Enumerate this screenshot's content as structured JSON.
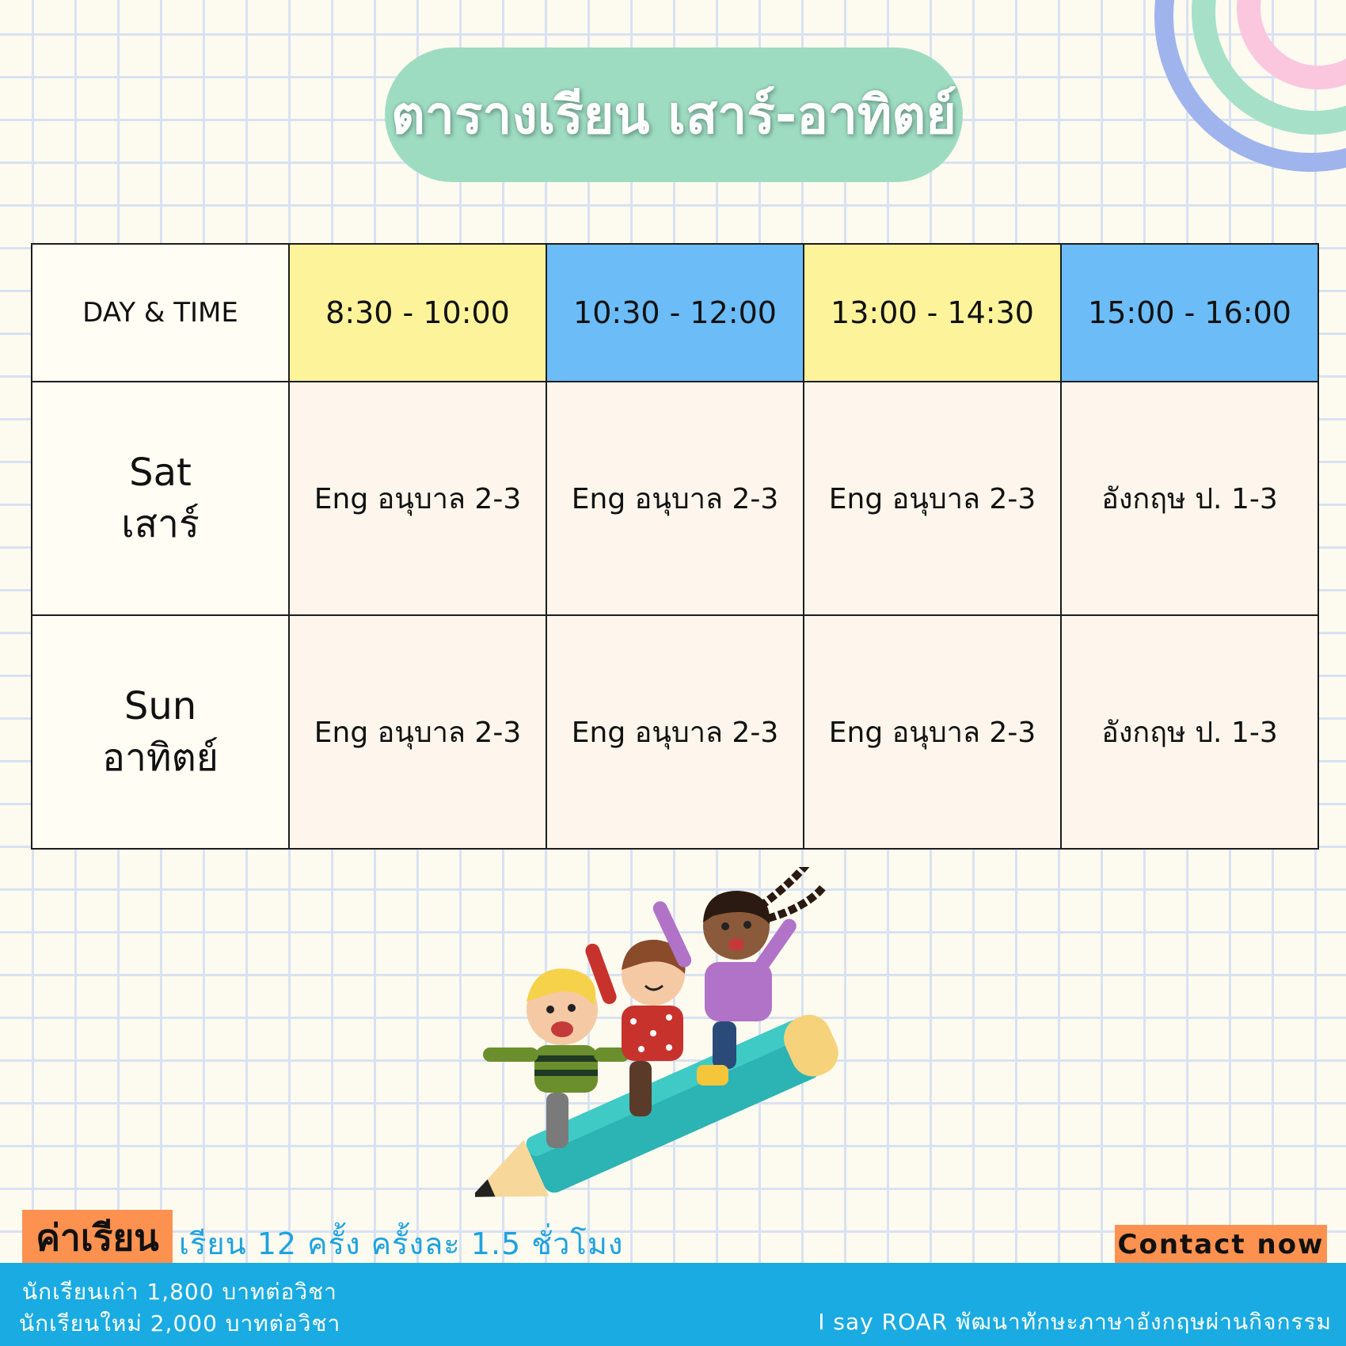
{
  "title": "ตารางเรียน เสาร์-อาทิตย์",
  "table": {
    "corner_label": "DAY & TIME",
    "time_slots": [
      "8:30 - 10:00",
      "10:30 - 12:00",
      "13:00 - 14:30",
      "15:00 - 16:00"
    ],
    "rows": [
      {
        "day_en": "Sat",
        "day_th": "เสาร์",
        "classes": [
          "Eng อนุบาล 2-3",
          "Eng อนุบาล 2-3",
          "Eng อนุบาล 2-3",
          "อังกฤษ ป. 1-3"
        ]
      },
      {
        "day_en": "Sun",
        "day_th": "อาทิตย์",
        "classes": [
          "Eng อนุบาล 2-3",
          "Eng อนุบาล 2-3",
          "Eng อนุบาล 2-3",
          "อังกฤษ ป. 1-3"
        ]
      }
    ]
  },
  "fee": {
    "label": "ค่าเรียน",
    "info": "เรียน 12 ครั้ง ครั้งละ 1.5 ชั่วโมง",
    "old_students": "นักเรียนเก่า 1,800 บาทต่อวิชา",
    "new_students": "นักเรียนใหม่ 2,000 บาทต่อวิชา"
  },
  "contact_label": "Contact now",
  "brand_line": "I say ROAR พัฒนาทักษะภาษาอังกฤษผ่านกิจกรรม",
  "colors": {
    "title_pill": "#9edcc2",
    "header_yellow": "#fdf39a",
    "header_blue": "#6bbcf7",
    "cell_bg": "#fef6ec",
    "accent_orange": "#fd9150",
    "footer_blue": "#19abe2"
  }
}
